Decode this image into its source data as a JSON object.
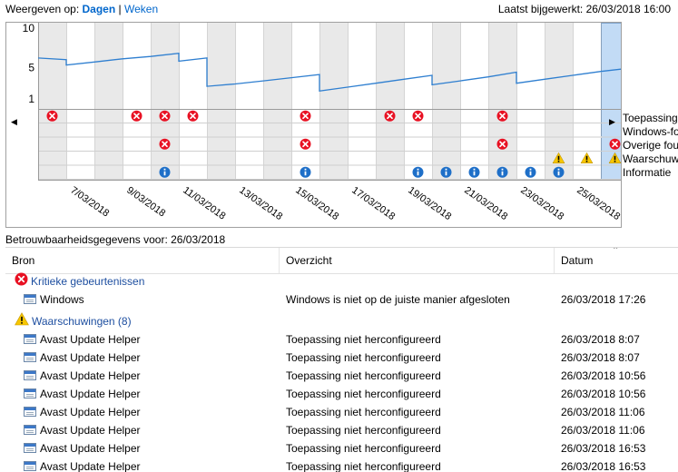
{
  "header": {
    "view_label": "Weergeven op:",
    "view_days": "Dagen",
    "view_sep": "|",
    "view_weeks": "Weken",
    "updated": "Laatst bijgewerkt: 26/03/2018 16:00"
  },
  "chart_data": {
    "type": "line",
    "y_ticks": [
      "10",
      "5",
      "1"
    ],
    "ylim": [
      1,
      10
    ],
    "x_ticks": [
      "7/03/2018",
      "9/03/2018",
      "11/03/2018",
      "13/03/2018",
      "15/03/2018",
      "17/03/2018",
      "19/03/2018",
      "21/03/2018",
      "23/03/2018",
      "25/03/2018"
    ],
    "days": [
      "06/03",
      "07/03",
      "08/03",
      "09/03",
      "10/03",
      "11/03",
      "12/03",
      "13/03",
      "14/03",
      "15/03",
      "16/03",
      "17/03",
      "18/03",
      "19/03",
      "20/03",
      "21/03",
      "22/03",
      "23/03",
      "24/03",
      "25/03",
      "26/03"
    ],
    "stability_index": [
      {
        "day": "06/03",
        "start": 6.2,
        "end": 6.0
      },
      {
        "day": "07/03",
        "start": 5.3,
        "end": 5.7
      },
      {
        "day": "08/03",
        "start": 5.7,
        "end": 6.1
      },
      {
        "day": "09/03",
        "start": 6.1,
        "end": 6.4
      },
      {
        "day": "10/03",
        "start": 6.4,
        "end": 6.8
      },
      {
        "day": "11/03",
        "start": 5.8,
        "end": 6.2
      },
      {
        "day": "12/03",
        "start": 2.6,
        "end": 2.9
      },
      {
        "day": "13/03",
        "start": 2.9,
        "end": 3.3
      },
      {
        "day": "14/03",
        "start": 3.3,
        "end": 3.7
      },
      {
        "day": "15/03",
        "start": 3.7,
        "end": 4.1
      },
      {
        "day": "16/03",
        "start": 2.0,
        "end": 2.5
      },
      {
        "day": "17/03",
        "start": 2.5,
        "end": 3.0
      },
      {
        "day": "18/03",
        "start": 3.0,
        "end": 3.5
      },
      {
        "day": "19/03",
        "start": 3.5,
        "end": 4.0
      },
      {
        "day": "20/03",
        "start": 2.8,
        "end": 3.3
      },
      {
        "day": "21/03",
        "start": 3.3,
        "end": 3.8
      },
      {
        "day": "22/03",
        "start": 3.8,
        "end": 4.4
      },
      {
        "day": "23/03",
        "start": 3.0,
        "end": 3.5
      },
      {
        "day": "24/03",
        "start": 3.5,
        "end": 4.0
      },
      {
        "day": "25/03",
        "start": 4.0,
        "end": 4.5
      },
      {
        "day": "26/03",
        "start": 4.5,
        "end": 4.9
      }
    ],
    "event_rows": [
      "Toepassingsfouten",
      "Windows-fouten",
      "Overige fouten",
      "Waarschuwingen",
      "Informatie"
    ],
    "events": [
      {
        "day": "06/03",
        "row": 0,
        "kind": "error"
      },
      {
        "day": "09/03",
        "row": 0,
        "kind": "error"
      },
      {
        "day": "10/03",
        "row": 0,
        "kind": "error"
      },
      {
        "day": "11/03",
        "row": 0,
        "kind": "error"
      },
      {
        "day": "15/03",
        "row": 0,
        "kind": "error"
      },
      {
        "day": "18/03",
        "row": 0,
        "kind": "error"
      },
      {
        "day": "19/03",
        "row": 0,
        "kind": "error"
      },
      {
        "day": "22/03",
        "row": 0,
        "kind": "error"
      },
      {
        "day": "10/03",
        "row": 2,
        "kind": "error"
      },
      {
        "day": "15/03",
        "row": 2,
        "kind": "error"
      },
      {
        "day": "22/03",
        "row": 2,
        "kind": "error"
      },
      {
        "day": "26/03",
        "row": 2,
        "kind": "error"
      },
      {
        "day": "24/03",
        "row": 3,
        "kind": "warning"
      },
      {
        "day": "25/03",
        "row": 3,
        "kind": "warning"
      },
      {
        "day": "26/03",
        "row": 3,
        "kind": "warning"
      },
      {
        "day": "10/03",
        "row": 4,
        "kind": "info"
      },
      {
        "day": "15/03",
        "row": 4,
        "kind": "info"
      },
      {
        "day": "19/03",
        "row": 4,
        "kind": "info"
      },
      {
        "day": "20/03",
        "row": 4,
        "kind": "info"
      },
      {
        "day": "21/03",
        "row": 4,
        "kind": "info"
      },
      {
        "day": "22/03",
        "row": 4,
        "kind": "info"
      },
      {
        "day": "23/03",
        "row": 4,
        "kind": "info"
      },
      {
        "day": "24/03",
        "row": 4,
        "kind": "info"
      }
    ],
    "selected_day": "26/03"
  },
  "legend": {
    "items": [
      "Toepassings",
      "Windows-fo",
      "Overige fou",
      "Waarschuw",
      "Informatie"
    ]
  },
  "nav": {
    "prev_icon": "triangle-left-icon",
    "next_icon": "triangle-right-icon"
  },
  "details": {
    "label": "Betrouwbaarheidsgegevens voor: 26/03/2018",
    "columns": [
      "Bron",
      "Overzicht",
      "Datum"
    ],
    "critical_group": "Kritieke gebeurtenissen",
    "critical_rows": [
      {
        "source": "Windows",
        "summary": "Windows is niet op de juiste manier afgesloten",
        "date": "26/03/2018 17:26"
      }
    ],
    "warning_group": "Waarschuwingen (8)",
    "warning_rows": [
      {
        "source": "Avast Update Helper",
        "summary": "Toepassing niet herconfigureerd",
        "date": "26/03/2018 8:07"
      },
      {
        "source": "Avast Update Helper",
        "summary": "Toepassing niet herconfigureerd",
        "date": "26/03/2018 8:07"
      },
      {
        "source": "Avast Update Helper",
        "summary": "Toepassing niet herconfigureerd",
        "date": "26/03/2018 10:56"
      },
      {
        "source": "Avast Update Helper",
        "summary": "Toepassing niet herconfigureerd",
        "date": "26/03/2018 10:56"
      },
      {
        "source": "Avast Update Helper",
        "summary": "Toepassing niet herconfigureerd",
        "date": "26/03/2018 11:06"
      },
      {
        "source": "Avast Update Helper",
        "summary": "Toepassing niet herconfigureerd",
        "date": "26/03/2018 11:06"
      },
      {
        "source": "Avast Update Helper",
        "summary": "Toepassing niet herconfigureerd",
        "date": "26/03/2018 16:53"
      },
      {
        "source": "Avast Update Helper",
        "summary": "Toepassing niet herconfigureerd",
        "date": "26/03/2018 16:53"
      }
    ]
  },
  "colors": {
    "line": "#2f7fd0",
    "alt_column": "#e9e9e9",
    "selected_column": "#c2dbf5",
    "error": "#e81123",
    "warning": "#f7c600",
    "info": "#1e6fc8",
    "link": "#0066cc"
  }
}
